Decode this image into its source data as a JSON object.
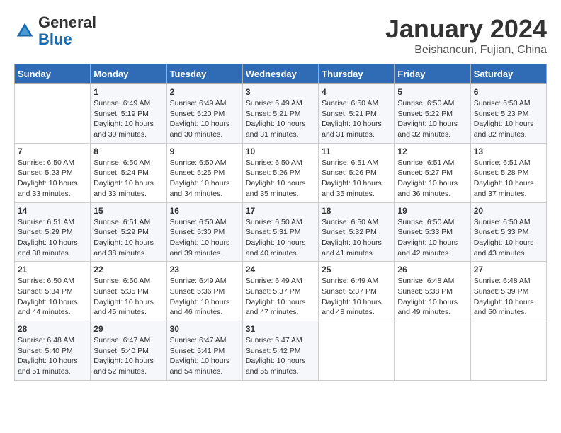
{
  "header": {
    "logo_general": "General",
    "logo_blue": "Blue",
    "month_title": "January 2024",
    "location": "Beishancun, Fujian, China"
  },
  "days_of_week": [
    "Sunday",
    "Monday",
    "Tuesday",
    "Wednesday",
    "Thursday",
    "Friday",
    "Saturday"
  ],
  "weeks": [
    [
      {
        "day": "",
        "content": ""
      },
      {
        "day": "1",
        "content": "Sunrise: 6:49 AM\nSunset: 5:19 PM\nDaylight: 10 hours\nand 30 minutes."
      },
      {
        "day": "2",
        "content": "Sunrise: 6:49 AM\nSunset: 5:20 PM\nDaylight: 10 hours\nand 30 minutes."
      },
      {
        "day": "3",
        "content": "Sunrise: 6:49 AM\nSunset: 5:21 PM\nDaylight: 10 hours\nand 31 minutes."
      },
      {
        "day": "4",
        "content": "Sunrise: 6:50 AM\nSunset: 5:21 PM\nDaylight: 10 hours\nand 31 minutes."
      },
      {
        "day": "5",
        "content": "Sunrise: 6:50 AM\nSunset: 5:22 PM\nDaylight: 10 hours\nand 32 minutes."
      },
      {
        "day": "6",
        "content": "Sunrise: 6:50 AM\nSunset: 5:23 PM\nDaylight: 10 hours\nand 32 minutes."
      }
    ],
    [
      {
        "day": "7",
        "content": "Sunrise: 6:50 AM\nSunset: 5:23 PM\nDaylight: 10 hours\nand 33 minutes."
      },
      {
        "day": "8",
        "content": "Sunrise: 6:50 AM\nSunset: 5:24 PM\nDaylight: 10 hours\nand 33 minutes."
      },
      {
        "day": "9",
        "content": "Sunrise: 6:50 AM\nSunset: 5:25 PM\nDaylight: 10 hours\nand 34 minutes."
      },
      {
        "day": "10",
        "content": "Sunrise: 6:50 AM\nSunset: 5:26 PM\nDaylight: 10 hours\nand 35 minutes."
      },
      {
        "day": "11",
        "content": "Sunrise: 6:51 AM\nSunset: 5:26 PM\nDaylight: 10 hours\nand 35 minutes."
      },
      {
        "day": "12",
        "content": "Sunrise: 6:51 AM\nSunset: 5:27 PM\nDaylight: 10 hours\nand 36 minutes."
      },
      {
        "day": "13",
        "content": "Sunrise: 6:51 AM\nSunset: 5:28 PM\nDaylight: 10 hours\nand 37 minutes."
      }
    ],
    [
      {
        "day": "14",
        "content": "Sunrise: 6:51 AM\nSunset: 5:29 PM\nDaylight: 10 hours\nand 38 minutes."
      },
      {
        "day": "15",
        "content": "Sunrise: 6:51 AM\nSunset: 5:29 PM\nDaylight: 10 hours\nand 38 minutes."
      },
      {
        "day": "16",
        "content": "Sunrise: 6:50 AM\nSunset: 5:30 PM\nDaylight: 10 hours\nand 39 minutes."
      },
      {
        "day": "17",
        "content": "Sunrise: 6:50 AM\nSunset: 5:31 PM\nDaylight: 10 hours\nand 40 minutes."
      },
      {
        "day": "18",
        "content": "Sunrise: 6:50 AM\nSunset: 5:32 PM\nDaylight: 10 hours\nand 41 minutes."
      },
      {
        "day": "19",
        "content": "Sunrise: 6:50 AM\nSunset: 5:33 PM\nDaylight: 10 hours\nand 42 minutes."
      },
      {
        "day": "20",
        "content": "Sunrise: 6:50 AM\nSunset: 5:33 PM\nDaylight: 10 hours\nand 43 minutes."
      }
    ],
    [
      {
        "day": "21",
        "content": "Sunrise: 6:50 AM\nSunset: 5:34 PM\nDaylight: 10 hours\nand 44 minutes."
      },
      {
        "day": "22",
        "content": "Sunrise: 6:50 AM\nSunset: 5:35 PM\nDaylight: 10 hours\nand 45 minutes."
      },
      {
        "day": "23",
        "content": "Sunrise: 6:49 AM\nSunset: 5:36 PM\nDaylight: 10 hours\nand 46 minutes."
      },
      {
        "day": "24",
        "content": "Sunrise: 6:49 AM\nSunset: 5:37 PM\nDaylight: 10 hours\nand 47 minutes."
      },
      {
        "day": "25",
        "content": "Sunrise: 6:49 AM\nSunset: 5:37 PM\nDaylight: 10 hours\nand 48 minutes."
      },
      {
        "day": "26",
        "content": "Sunrise: 6:48 AM\nSunset: 5:38 PM\nDaylight: 10 hours\nand 49 minutes."
      },
      {
        "day": "27",
        "content": "Sunrise: 6:48 AM\nSunset: 5:39 PM\nDaylight: 10 hours\nand 50 minutes."
      }
    ],
    [
      {
        "day": "28",
        "content": "Sunrise: 6:48 AM\nSunset: 5:40 PM\nDaylight: 10 hours\nand 51 minutes."
      },
      {
        "day": "29",
        "content": "Sunrise: 6:47 AM\nSunset: 5:40 PM\nDaylight: 10 hours\nand 52 minutes."
      },
      {
        "day": "30",
        "content": "Sunrise: 6:47 AM\nSunset: 5:41 PM\nDaylight: 10 hours\nand 54 minutes."
      },
      {
        "day": "31",
        "content": "Sunrise: 6:47 AM\nSunset: 5:42 PM\nDaylight: 10 hours\nand 55 minutes."
      },
      {
        "day": "",
        "content": ""
      },
      {
        "day": "",
        "content": ""
      },
      {
        "day": "",
        "content": ""
      }
    ]
  ]
}
